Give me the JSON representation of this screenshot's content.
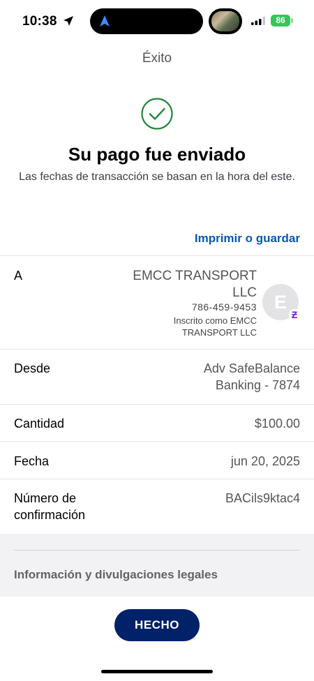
{
  "status_bar": {
    "time": "10:38",
    "battery": "86"
  },
  "header": {
    "title": "Éxito",
    "heading": "Su pago fue enviado",
    "subtitle": "Las fechas de transacción se basan en la hora del este.",
    "print_link": "Imprimir o guardar"
  },
  "details": {
    "to": {
      "label": "A",
      "name": "EMCC TRANSPORT LLC",
      "phone": "786-459-9453",
      "enrolled": "Inscrito como EMCC TRANSPORT LLC",
      "avatar_initial": "E",
      "badge_icon": "zelle-icon"
    },
    "from": {
      "label": "Desde",
      "value": "Adv SafeBalance Banking - 7874"
    },
    "amount": {
      "label": "Cantidad",
      "value": "$100.00"
    },
    "date": {
      "label": "Fecha",
      "value": "jun 20, 2025"
    },
    "confirmation": {
      "label": "Número de confirmación",
      "value": "BACils9ktac4"
    }
  },
  "legal": {
    "label": "Información y divulgaciones legales"
  },
  "done_button": {
    "label": "HECHO"
  },
  "colors": {
    "accent": "#0a58b3",
    "button": "#012169",
    "success": "#1f8a3c",
    "zelle": "#6d1ed4"
  }
}
